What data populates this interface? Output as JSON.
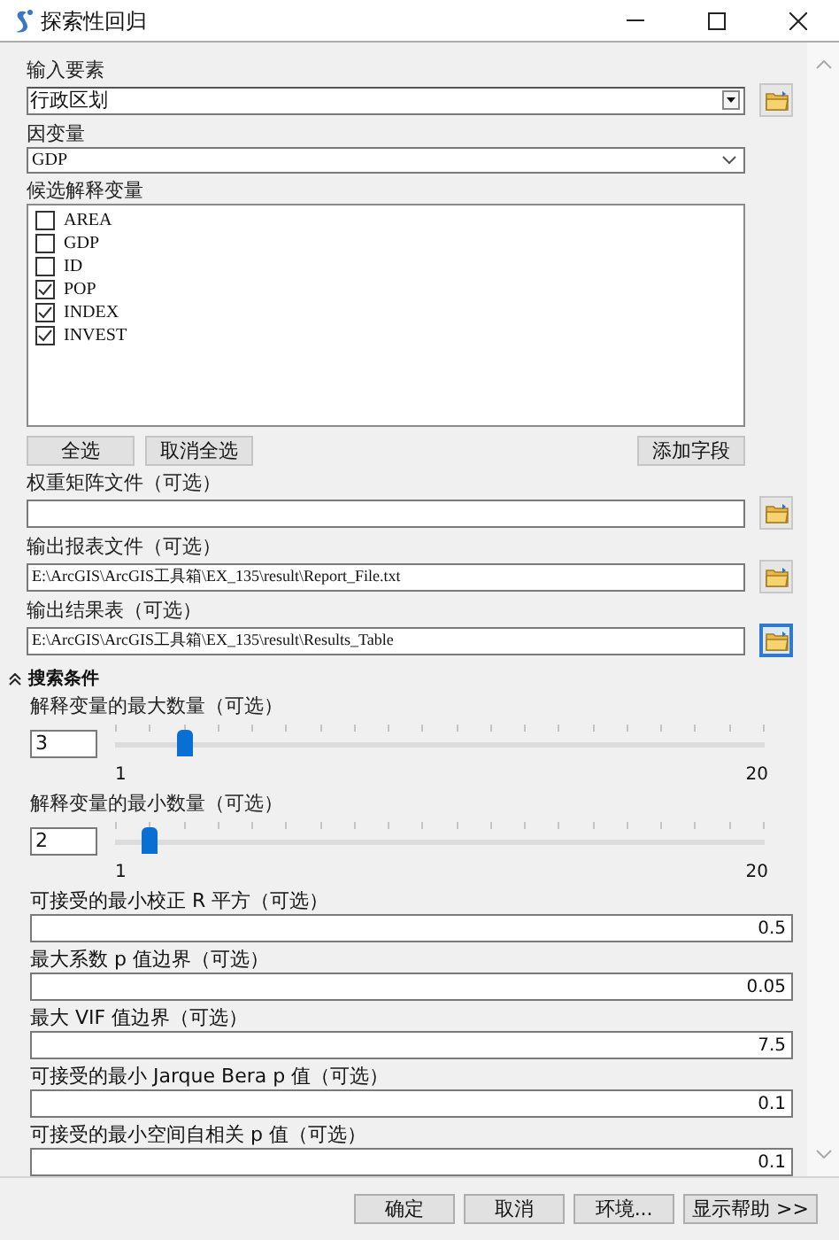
{
  "window": {
    "title": "探索性回归"
  },
  "input_features": {
    "label": "输入要素",
    "value": "行政区划"
  },
  "dependent_variable": {
    "label": "因变量",
    "value": "GDP"
  },
  "candidates": {
    "label": "候选解释变量",
    "items": [
      {
        "name": "AREA",
        "checked": false
      },
      {
        "name": "GDP",
        "checked": false
      },
      {
        "name": "ID",
        "checked": false
      },
      {
        "name": "POP",
        "checked": true
      },
      {
        "name": "INDEX",
        "checked": true
      },
      {
        "name": "INVEST",
        "checked": true
      }
    ]
  },
  "list_buttons": [
    "全选",
    "取消全选"
  ],
  "add_field_button": "添加字段",
  "files": [
    {
      "label": "权重矩阵文件（可选）",
      "focused": false
    },
    {
      "label": "输出报表文件（可选）",
      "value": "E:\\ArcGIS\\ArcGIS工具箱\\EX_135\\result\\Report_File.txt",
      "focused": false
    },
    {
      "label": "输出结果表（可选）",
      "value": "E:\\ArcGIS\\ArcGIS工具箱\\EX_135\\result\\Results_Table",
      "focused": true
    }
  ],
  "search_section": {
    "title": "搜索条件",
    "expanded": true,
    "sliders": [
      {
        "label": "解释变量的最大数量（可选）",
        "value": "3",
        "level": 0.105,
        "min_label": "1",
        "max_label": "20"
      },
      {
        "label": "解释变量的最小数量（可选）",
        "value": "2",
        "level": 0.053,
        "min_label": "1",
        "max_label": "20"
      }
    ],
    "thresholds": [
      {
        "label": "可接受的最小校正 R 平方（可选）",
        "value": "0.5"
      },
      {
        "label": "最大系数 p 值边界（可选）",
        "value": "0.05"
      },
      {
        "label": "最大 VIF 值边界（可选）",
        "value": "7.5"
      },
      {
        "label": "可接受的最小 Jarque Bera p 值（可选）",
        "value": "0.1"
      },
      {
        "label": "可接受的最小空间自相关 p 值（可选）",
        "value": "0.1"
      }
    ]
  },
  "buttons": [
    "确定",
    "取消",
    "环境...",
    "显示帮助 >>"
  ]
}
